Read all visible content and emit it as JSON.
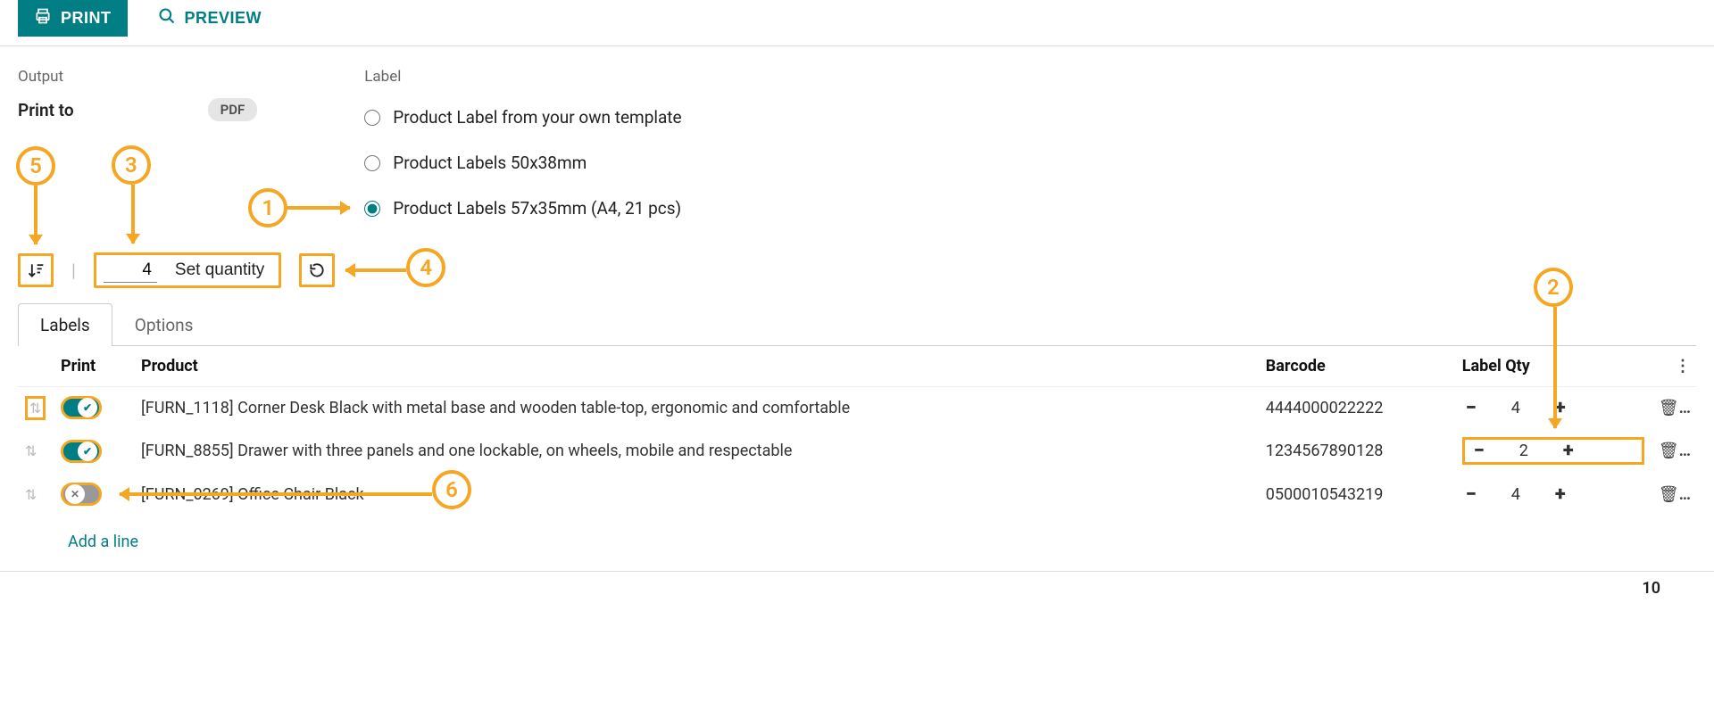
{
  "toolbar": {
    "print_label": "PRINT",
    "preview_label": "PREVIEW"
  },
  "output": {
    "section_label": "Output",
    "print_to_label": "Print to",
    "format_badge": "PDF"
  },
  "label_section": {
    "section_label": "Label",
    "options": [
      {
        "label": "Product Label from your own template",
        "selected": false
      },
      {
        "label": "Product Labels 50x38mm",
        "selected": false
      },
      {
        "label": "Product Labels 57x35mm (A4, 21 pcs)",
        "selected": true
      }
    ]
  },
  "qtybar": {
    "qty_value": "4",
    "set_qty_label": "Set quantity"
  },
  "tabs": {
    "labels": "Labels",
    "options": "Options"
  },
  "table": {
    "headers": {
      "print": "Print",
      "product": "Product",
      "barcode": "Barcode",
      "label_qty": "Label Qty"
    },
    "rows": [
      {
        "print_on": true,
        "product": "[FURN_1118] Corner Desk Black with metal base and wooden table-top, ergonomic and comfortable",
        "barcode": "4444000022222",
        "qty": "4"
      },
      {
        "print_on": true,
        "product": "[FURN_8855] Drawer with three panels and one lockable, on wheels, mobile and respectable",
        "barcode": "1234567890128",
        "qty": "2"
      },
      {
        "print_on": false,
        "product": "[FURN_0269] Office Chair Black",
        "barcode": "0500010543219",
        "qty": "4"
      }
    ],
    "add_line": "Add a line"
  },
  "footer": {
    "page_number": "10"
  },
  "annotations": [
    "1",
    "2",
    "3",
    "4",
    "5",
    "6"
  ]
}
